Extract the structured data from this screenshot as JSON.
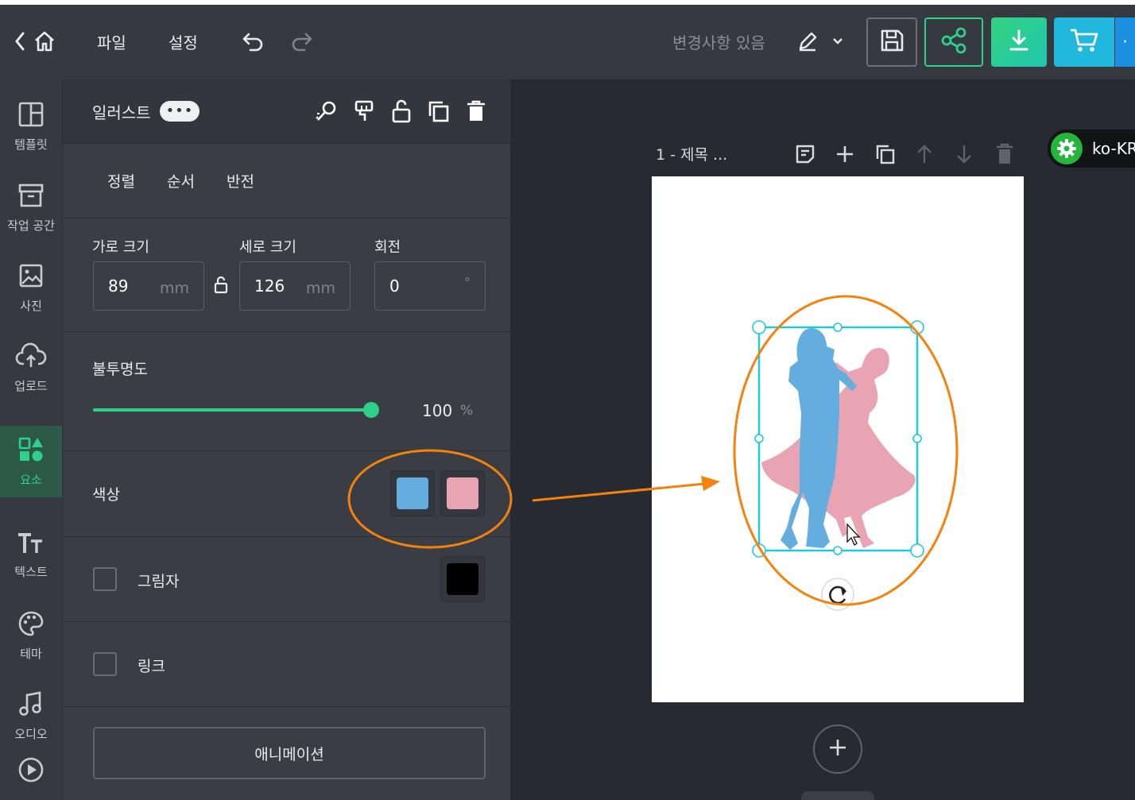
{
  "topbar": {
    "menu": [
      "파일",
      "설정"
    ],
    "status": "변경사항 있음"
  },
  "rail": {
    "items": [
      {
        "label": "템플릿",
        "icon": "template-icon",
        "active": false
      },
      {
        "label": "작업 공간",
        "icon": "workspace-icon",
        "active": false
      },
      {
        "label": "사진",
        "icon": "photo-icon",
        "active": false
      },
      {
        "label": "업로드",
        "icon": "upload-icon",
        "active": false
      },
      {
        "label": "요소",
        "icon": "elements-icon",
        "active": true
      },
      {
        "label": "텍스트",
        "icon": "text-icon",
        "active": false
      },
      {
        "label": "테마",
        "icon": "palette-icon",
        "active": false
      },
      {
        "label": "오디오",
        "icon": "music-icon",
        "active": false
      },
      {
        "label": "",
        "icon": "play-icon",
        "active": false
      }
    ]
  },
  "panel": {
    "title": "일러스트",
    "tabs": [
      "정렬",
      "순서",
      "반전"
    ],
    "size": {
      "width_label": "가로 크기",
      "width_value": "89",
      "width_unit": "mm",
      "height_label": "세로 크기",
      "height_value": "126",
      "height_unit": "mm",
      "rotation_label": "회전",
      "rotation_value": "0",
      "rotation_unit": "°"
    },
    "opacity": {
      "label": "불투명도",
      "value": "100",
      "unit": "%",
      "level": 1.0
    },
    "color": {
      "label": "색상",
      "swatches": [
        "#64aedf",
        "#e8a4b3"
      ]
    },
    "shadow": {
      "label": "그림자",
      "color": "#000000",
      "checked": false
    },
    "link": {
      "label": "링크",
      "checked": false
    },
    "animation_label": "애니메이션"
  },
  "canvas": {
    "page_title": "1 - 제목 ...",
    "lang_badge": "ko-KR"
  },
  "colors": {
    "accent": "#2fcf8c",
    "annotation": "#f4820b",
    "selection": "#1ec9e0"
  }
}
